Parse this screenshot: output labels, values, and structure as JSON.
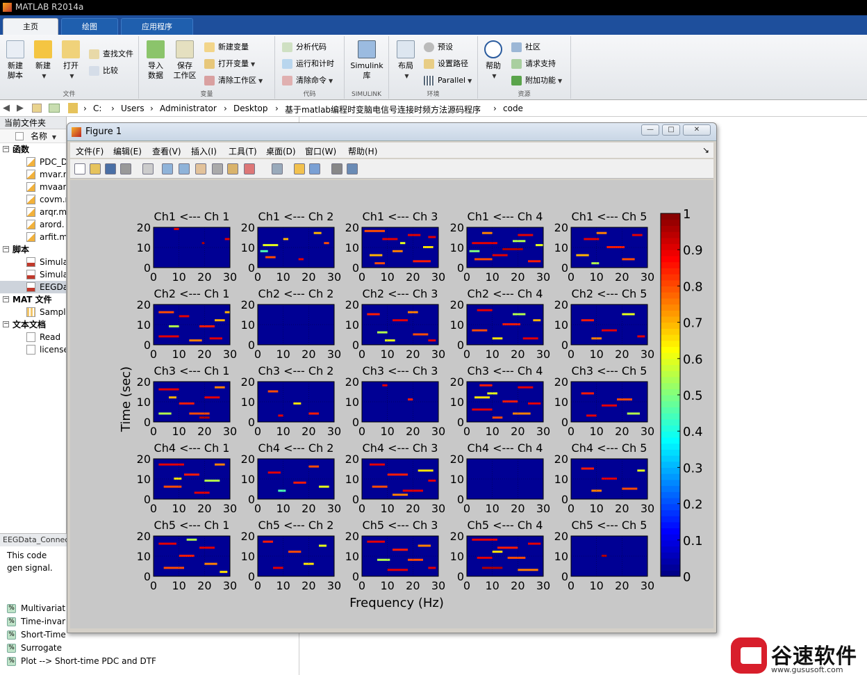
{
  "app": {
    "title": "MATLAB R2014a"
  },
  "tabs": [
    "主页",
    "绘图",
    "应用程序"
  ],
  "ribbon": {
    "file_group": {
      "new_script": "新建\n脚本",
      "new": "新建",
      "open": "打开",
      "find_files": "查找文件",
      "compare": "比较",
      "name": "文件"
    },
    "variable_group": {
      "import": "导入\n数据",
      "save_ws": "保存\n工作区",
      "new_var": "新建变量",
      "open_var": "打开变量",
      "clear_ws": "清除工作区",
      "name": "变量"
    },
    "code_group": {
      "analyze": "分析代码",
      "run_time": "运行和计时",
      "clear_cmd": "清除命令",
      "name": "代码"
    },
    "simulink_group": {
      "lib": "Simulink\n库",
      "name": "SIMULINK"
    },
    "env_group": {
      "layout": "布局",
      "prefs": "预设",
      "set_path": "设置路径",
      "parallel": "Parallel",
      "name": "环境"
    },
    "res_group": {
      "help": "帮助",
      "community": "社区",
      "support": "请求支持",
      "addons": "附加功能",
      "name": "资源"
    }
  },
  "address": {
    "crumbs": [
      "C:",
      "Users",
      "Administrator",
      "Desktop",
      "基于matlab编程时变脑电信号连接时频方法源码程序",
      "code"
    ]
  },
  "current_folder": {
    "title": "当前文件夹",
    "col_name": "名称",
    "sections": [
      {
        "label": "函数",
        "items": [
          "PDC_D",
          "mvar.m",
          "mvaar.",
          "covm.m",
          "arqr.m",
          "arord.",
          "arfit.m"
        ]
      },
      {
        "label": "脚本",
        "items": [
          "Simula",
          "Simula",
          "EEGDa"
        ]
      },
      {
        "label": "MAT 文件",
        "items": [
          "Sampl"
        ]
      },
      {
        "label": "文本文档",
        "items": [
          "Read",
          "license"
        ]
      }
    ]
  },
  "details": {
    "title": "EEGData_Connectivity",
    "desc": "This code gen signal.",
    "list": [
      "Multivariat",
      "Time-invar",
      "Short-Time",
      "Surrogate",
      "Plot --> Short-time PDC and DTF"
    ]
  },
  "figure": {
    "title": "Figure 1",
    "menu": [
      "文件(F)",
      "编辑(E)",
      "查看(V)",
      "插入(I)",
      "工具(T)",
      "桌面(D)",
      "窗口(W)",
      "帮助(H)"
    ]
  },
  "brand": {
    "name": "谷速软件",
    "url": "www.gususoft.com"
  },
  "chart_data": {
    "type": "heatmap",
    "layout": "5x5 grid of time-frequency maps",
    "titles": [
      [
        "Ch1 <--- Ch 1",
        "Ch1 <--- Ch 2",
        "Ch1 <--- Ch 3",
        "Ch1 <--- Ch 4",
        "Ch1 <--- Ch 5"
      ],
      [
        "Ch2 <--- Ch 1",
        "Ch2 <--- Ch 2",
        "Ch2 <--- Ch 3",
        "Ch2 <--- Ch 4",
        "Ch2 <--- Ch 5"
      ],
      [
        "Ch3 <--- Ch 1",
        "Ch3 <--- Ch 2",
        "Ch3 <--- Ch 3",
        "Ch3 <--- Ch 4",
        "Ch3 <--- Ch 5"
      ],
      [
        "Ch4 <--- Ch 1",
        "Ch4 <--- Ch 2",
        "Ch4 <--- Ch 3",
        "Ch4 <--- Ch 4",
        "Ch4 <--- Ch 5"
      ],
      [
        "Ch5 <--- Ch 1",
        "Ch5 <--- Ch 2",
        "Ch5 <--- Ch 3",
        "Ch5 <--- Ch 4",
        "Ch5 <--- Ch 5"
      ]
    ],
    "xlabel": "Frequency (Hz)",
    "ylabel": "Time (sec)",
    "xticks": [
      0,
      10,
      20,
      30
    ],
    "yticks": [
      0,
      10,
      20
    ],
    "xlim": [
      0,
      30
    ],
    "ylim": [
      0,
      20
    ],
    "grid": true,
    "colorbar": {
      "ticks": [
        0,
        0.1,
        0.2,
        0.3,
        0.4,
        0.5,
        0.6,
        0.7,
        0.8,
        0.9,
        1
      ],
      "labels": [
        "0",
        "0.1",
        "0.2",
        "0.3",
        "0.4",
        "0.5",
        "0.6",
        "0.7",
        "0.8",
        "0.9",
        "1"
      ],
      "colormap": "jet",
      "range": [
        0,
        1
      ]
    },
    "cell_activity": [
      [
        0.03,
        0.18,
        0.45,
        0.55,
        0.22
      ],
      [
        0.42,
        0.0,
        0.3,
        0.38,
        0.2
      ],
      [
        0.35,
        0.12,
        0.02,
        0.55,
        0.3
      ],
      [
        0.4,
        0.18,
        0.45,
        0.0,
        0.25
      ],
      [
        0.42,
        0.16,
        0.4,
        0.62,
        0.02
      ]
    ],
    "blocks": [
      [
        [
          [
            8,
            19,
            2,
            0.9
          ],
          [
            19,
            12,
            1,
            0.95
          ],
          [
            28,
            14,
            2,
            0.9
          ]
        ],
        [
          [
            2,
            11,
            6,
            0.6
          ],
          [
            3,
            5,
            4,
            0.8
          ],
          [
            1,
            8,
            3,
            0.45
          ],
          [
            10,
            14,
            2,
            0.7
          ],
          [
            16,
            4,
            2,
            0.9
          ],
          [
            22,
            17,
            3,
            0.7
          ],
          [
            26,
            12,
            2,
            0.8
          ]
        ],
        [
          [
            1,
            18,
            8,
            0.8
          ],
          [
            8,
            14,
            6,
            0.9
          ],
          [
            12,
            8,
            4,
            0.75
          ],
          [
            18,
            16,
            5,
            0.9
          ],
          [
            24,
            10,
            4,
            0.65
          ],
          [
            3,
            6,
            5,
            0.7
          ],
          [
            20,
            3,
            7,
            0.85
          ],
          [
            26,
            15,
            3,
            0.9
          ],
          [
            15,
            12,
            2,
            0.6
          ],
          [
            5,
            2,
            4,
            0.8
          ]
        ],
        [
          [
            2,
            12,
            10,
            0.9
          ],
          [
            14,
            9,
            8,
            0.95
          ],
          [
            3,
            4,
            7,
            0.8
          ],
          [
            20,
            16,
            6,
            0.9
          ],
          [
            18,
            13,
            5,
            0.55
          ],
          [
            6,
            17,
            4,
            0.75
          ],
          [
            10,
            6,
            6,
            0.9
          ],
          [
            24,
            3,
            5,
            0.85
          ],
          [
            27,
            11,
            3,
            0.6
          ],
          [
            1,
            8,
            4,
            0.5
          ]
        ],
        [
          [
            5,
            14,
            6,
            0.9
          ],
          [
            14,
            10,
            7,
            0.85
          ],
          [
            20,
            4,
            5,
            0.8
          ],
          [
            2,
            6,
            5,
            0.7
          ],
          [
            10,
            17,
            4,
            0.75
          ],
          [
            24,
            16,
            4,
            0.9
          ],
          [
            8,
            2,
            3,
            0.55
          ]
        ]
      ],
      [
        [
          [
            2,
            16,
            6,
            0.8
          ],
          [
            10,
            14,
            4,
            0.9
          ],
          [
            2,
            4,
            8,
            0.9
          ],
          [
            18,
            9,
            6,
            0.85
          ],
          [
            14,
            2,
            5,
            0.75
          ],
          [
            24,
            12,
            4,
            0.7
          ],
          [
            6,
            9,
            4,
            0.55
          ],
          [
            22,
            3,
            5,
            0.9
          ],
          [
            28,
            16,
            2,
            0.7
          ]
        ],
        [],
        [
          [
            2,
            15,
            5,
            0.85
          ],
          [
            12,
            12,
            6,
            0.9
          ],
          [
            6,
            6,
            4,
            0.55
          ],
          [
            20,
            5,
            6,
            0.8
          ],
          [
            18,
            16,
            4,
            0.75
          ],
          [
            26,
            2,
            3,
            0.9
          ],
          [
            9,
            2,
            4,
            0.6
          ]
        ],
        [
          [
            4,
            17,
            6,
            0.9
          ],
          [
            14,
            10,
            7,
            0.85
          ],
          [
            2,
            7,
            6,
            0.8
          ],
          [
            22,
            3,
            6,
            0.9
          ],
          [
            10,
            3,
            4,
            0.65
          ],
          [
            18,
            15,
            5,
            0.55
          ],
          [
            26,
            12,
            3,
            0.7
          ]
        ],
        [
          [
            4,
            12,
            5,
            0.85
          ],
          [
            12,
            7,
            6,
            0.9
          ],
          [
            20,
            15,
            5,
            0.6
          ],
          [
            26,
            4,
            3,
            0.9
          ],
          [
            8,
            3,
            4,
            0.75
          ]
        ]
      ],
      [
        [
          [
            2,
            16,
            8,
            0.9
          ],
          [
            10,
            9,
            6,
            0.85
          ],
          [
            2,
            4,
            5,
            0.55
          ],
          [
            20,
            12,
            6,
            0.9
          ],
          [
            14,
            4,
            8,
            0.8
          ],
          [
            24,
            17,
            4,
            0.75
          ],
          [
            18,
            2,
            4,
            0.95
          ],
          [
            6,
            12,
            3,
            0.7
          ]
        ],
        [
          [
            4,
            15,
            4,
            0.8
          ],
          [
            14,
            9,
            3,
            0.65
          ],
          [
            20,
            4,
            4,
            0.85
          ],
          [
            8,
            3,
            2,
            0.9
          ]
        ],
        [
          [
            8,
            18,
            2,
            0.9
          ],
          [
            18,
            11,
            2,
            0.85
          ]
        ],
        [
          [
            3,
            12,
            6,
            0.65
          ],
          [
            8,
            14,
            4,
            0.6
          ],
          [
            2,
            6,
            8,
            0.9
          ],
          [
            14,
            10,
            6,
            0.85
          ],
          [
            20,
            17,
            6,
            0.9
          ],
          [
            18,
            4,
            7,
            0.75
          ],
          [
            24,
            9,
            5,
            0.9
          ],
          [
            10,
            2,
            4,
            0.8
          ],
          [
            5,
            18,
            5,
            0.85
          ]
        ],
        [
          [
            4,
            14,
            5,
            0.85
          ],
          [
            12,
            8,
            6,
            0.9
          ],
          [
            18,
            11,
            6,
            0.8
          ],
          [
            22,
            4,
            5,
            0.55
          ],
          [
            6,
            3,
            4,
            0.9
          ]
        ]
      ],
      [
        [
          [
            2,
            17,
            10,
            0.9
          ],
          [
            12,
            12,
            6,
            0.85
          ],
          [
            4,
            6,
            7,
            0.8
          ],
          [
            20,
            9,
            6,
            0.55
          ],
          [
            16,
            3,
            6,
            0.9
          ],
          [
            24,
            17,
            4,
            0.75
          ],
          [
            8,
            10,
            3,
            0.65
          ]
        ],
        [
          [
            4,
            13,
            5,
            0.9
          ],
          [
            14,
            8,
            5,
            0.85
          ],
          [
            20,
            16,
            4,
            0.8
          ],
          [
            8,
            4,
            3,
            0.45
          ],
          [
            24,
            6,
            4,
            0.6
          ]
        ],
        [
          [
            3,
            17,
            6,
            0.9
          ],
          [
            10,
            12,
            8,
            0.85
          ],
          [
            4,
            6,
            6,
            0.8
          ],
          [
            16,
            4,
            8,
            0.9
          ],
          [
            22,
            14,
            6,
            0.65
          ],
          [
            12,
            2,
            6,
            0.75
          ],
          [
            26,
            9,
            3,
            0.9
          ]
        ],
        [],
        [
          [
            4,
            15,
            5,
            0.85
          ],
          [
            12,
            10,
            6,
            0.9
          ],
          [
            20,
            5,
            6,
            0.8
          ],
          [
            26,
            14,
            3,
            0.6
          ],
          [
            8,
            4,
            4,
            0.75
          ]
        ]
      ],
      [
        [
          [
            2,
            16,
            7,
            0.9
          ],
          [
            10,
            10,
            6,
            0.85
          ],
          [
            4,
            4,
            8,
            0.8
          ],
          [
            18,
            14,
            6,
            0.9
          ],
          [
            20,
            6,
            5,
            0.75
          ],
          [
            26,
            2,
            3,
            0.65
          ],
          [
            13,
            18,
            4,
            0.55
          ]
        ],
        [
          [
            2,
            17,
            4,
            0.85
          ],
          [
            12,
            12,
            5,
            0.8
          ],
          [
            18,
            6,
            4,
            0.65
          ],
          [
            6,
            4,
            4,
            0.9
          ],
          [
            24,
            15,
            3,
            0.6
          ]
        ],
        [
          [
            2,
            17,
            7,
            0.9
          ],
          [
            12,
            13,
            6,
            0.85
          ],
          [
            6,
            8,
            5,
            0.55
          ],
          [
            18,
            8,
            6,
            0.8
          ],
          [
            10,
            3,
            8,
            0.9
          ],
          [
            22,
            15,
            5,
            0.75
          ],
          [
            26,
            4,
            3,
            0.9
          ]
        ],
        [
          [
            2,
            18,
            10,
            0.9
          ],
          [
            12,
            14,
            8,
            0.85
          ],
          [
            4,
            9,
            6,
            0.9
          ],
          [
            16,
            9,
            7,
            0.8
          ],
          [
            6,
            4,
            8,
            0.95
          ],
          [
            20,
            3,
            8,
            0.75
          ],
          [
            24,
            16,
            5,
            0.9
          ],
          [
            10,
            12,
            4,
            0.65
          ]
        ],
        [
          [
            12,
            10,
            2,
            0.95
          ]
        ]
      ]
    ]
  }
}
